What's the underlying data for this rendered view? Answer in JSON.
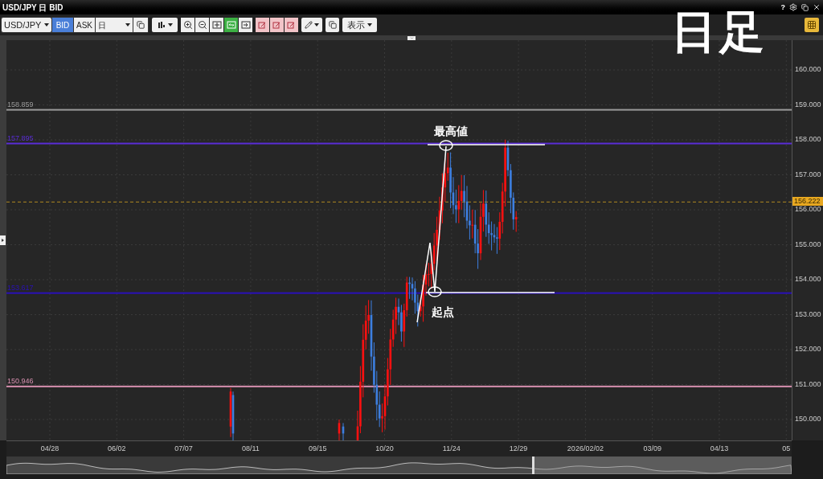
{
  "window": {
    "title": "USD/JPY 日 BID",
    "help": "?"
  },
  "toolbar": {
    "symbol": "USD/JPY",
    "price_sides": [
      {
        "label": "BID",
        "selected": true
      },
      {
        "label": "ASK",
        "selected": false
      }
    ],
    "timeframe": "日",
    "display_menu": "表示",
    "tools": [
      {
        "kind": "zoom-in",
        "active": false
      },
      {
        "kind": "zoom-out",
        "active": false
      },
      {
        "kind": "fit",
        "active": false
      },
      {
        "kind": "scroll",
        "active": true
      },
      {
        "kind": "end",
        "active": false
      }
    ]
  },
  "overlay_caption": "日足",
  "chart": {
    "level_lines": [
      {
        "label": "158.859",
        "color": "#9a9a9a"
      },
      {
        "label": "157.895",
        "color": "#5a2cd6"
      },
      {
        "label": "153.617",
        "color": "#2a10b8"
      },
      {
        "label": "150.946",
        "color": "#d890b0"
      }
    ],
    "current_price": "156.222",
    "annotations": [
      {
        "kind": "high",
        "text": "最高値"
      },
      {
        "kind": "start",
        "text": "起点"
      }
    ],
    "y_axis": [
      "160.000",
      "159.000",
      "158.000",
      "157.000",
      "156.000",
      "155.000",
      "154.000",
      "153.000",
      "152.000",
      "151.000",
      "150.000"
    ],
    "x_axis": [
      "04/28",
      "06/02",
      "07/07",
      "08/11",
      "09/15",
      "10/20",
      "11/24",
      "12/29",
      "2026/02/02",
      "03/09",
      "04/13",
      "05"
    ]
  }
}
